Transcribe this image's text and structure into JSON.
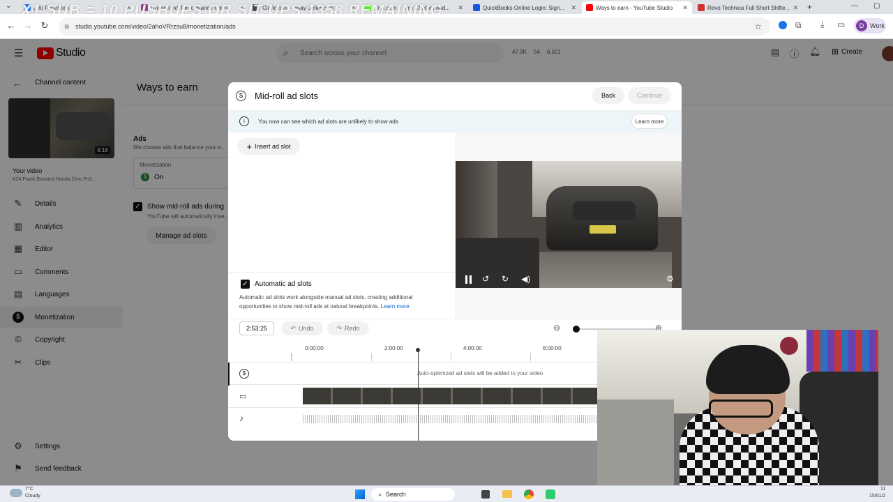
{
  "browser": {
    "overlay_title": "X1 SUB = 10 PUSHUPS OR SIT UPS 1358 REMAINING",
    "tabs": [
      {
        "label": "(16) Facebook",
        "color": "#1877f2"
      },
      {
        "label": "Dhanmondi Performance Parts",
        "color": "#9b2f85"
      },
      {
        "label": "Clarksons – eBay Seller Hub",
        "color": "#444"
      },
      {
        "label": "Kick.com – Kick Chatbot and...",
        "color": "#53fc18"
      },
      {
        "label": "QuickBooks Online Login: Sign...",
        "color": "#1a56db"
      },
      {
        "label": "Ways to earn - YouTube Studio",
        "color": "#ff0000"
      },
      {
        "label": "Revo Technica Full Short Shifte...",
        "color": "#d32f2f"
      }
    ],
    "url": "studio.youtube.com/video/2ahoVRrzsu8/monetization/ads",
    "profile_label": "Work",
    "profile_initial": "D"
  },
  "header": {
    "logo_text": "Studio",
    "search_placeholder": "Search across your channel",
    "stats": [
      "47.9K",
      "54",
      "6,501"
    ],
    "create_label": "Create"
  },
  "sidebar": {
    "back_label": "Channel content",
    "thumb_duration": "9:16",
    "your_video_label": "Your video",
    "video_title": "K24 Frank Boosted Honda Civic Fn2...",
    "items": [
      {
        "label": "Details",
        "icon": "pencil-icon"
      },
      {
        "label": "Analytics",
        "icon": "analytics-icon"
      },
      {
        "label": "Editor",
        "icon": "editor-icon"
      },
      {
        "label": "Comments",
        "icon": "comments-icon"
      },
      {
        "label": "Languages",
        "icon": "subtitles-icon"
      },
      {
        "label": "Monetization",
        "icon": "dollar-icon"
      },
      {
        "label": "Copyright",
        "icon": "copyright-icon"
      },
      {
        "label": "Clips",
        "icon": "scissors-icon"
      }
    ],
    "settings_label": "Settings",
    "feedback_label": "Send feedback"
  },
  "page": {
    "title": "Ways to earn",
    "ads_heading": "Ads",
    "ads_subtitle": "We choose ads that balance your e...",
    "monetization_label": "Monetization",
    "monetization_value": "On",
    "midroll_checkbox_label": "Show mid-roll ads during",
    "midroll_sub": "YouTube will automatically inse...",
    "manage_button": "Manage ad slots"
  },
  "dialog": {
    "title": "Mid-roll ad slots",
    "back_button": "Back",
    "continue_button": "Continue",
    "info_text": "You now can see which ad slots are unlikely to show ads",
    "learn_more_button": "Learn more",
    "insert_button": "Insert ad slot",
    "auto_label": "Automatic ad slots",
    "auto_desc": "Automatic ad slots work alongside manual ad slots, creating additional opportunities to show mid-roll ads at natural breakpoints.",
    "auto_learn_more": "Learn more",
    "current_time": "2:53:25",
    "undo_label": "Undo",
    "redo_label": "Redo",
    "ticks": [
      "0:00:00",
      "2:00:00",
      "4:00:00",
      "6:00:00"
    ],
    "ads_row_message": "Auto-optimized ad slots will be added to your video"
  },
  "taskbar": {
    "weather_temp": "7°C",
    "weather_desc": "Cloudy",
    "search_label": "Search",
    "clock_time": "11",
    "clock_date": "15/01/2"
  }
}
